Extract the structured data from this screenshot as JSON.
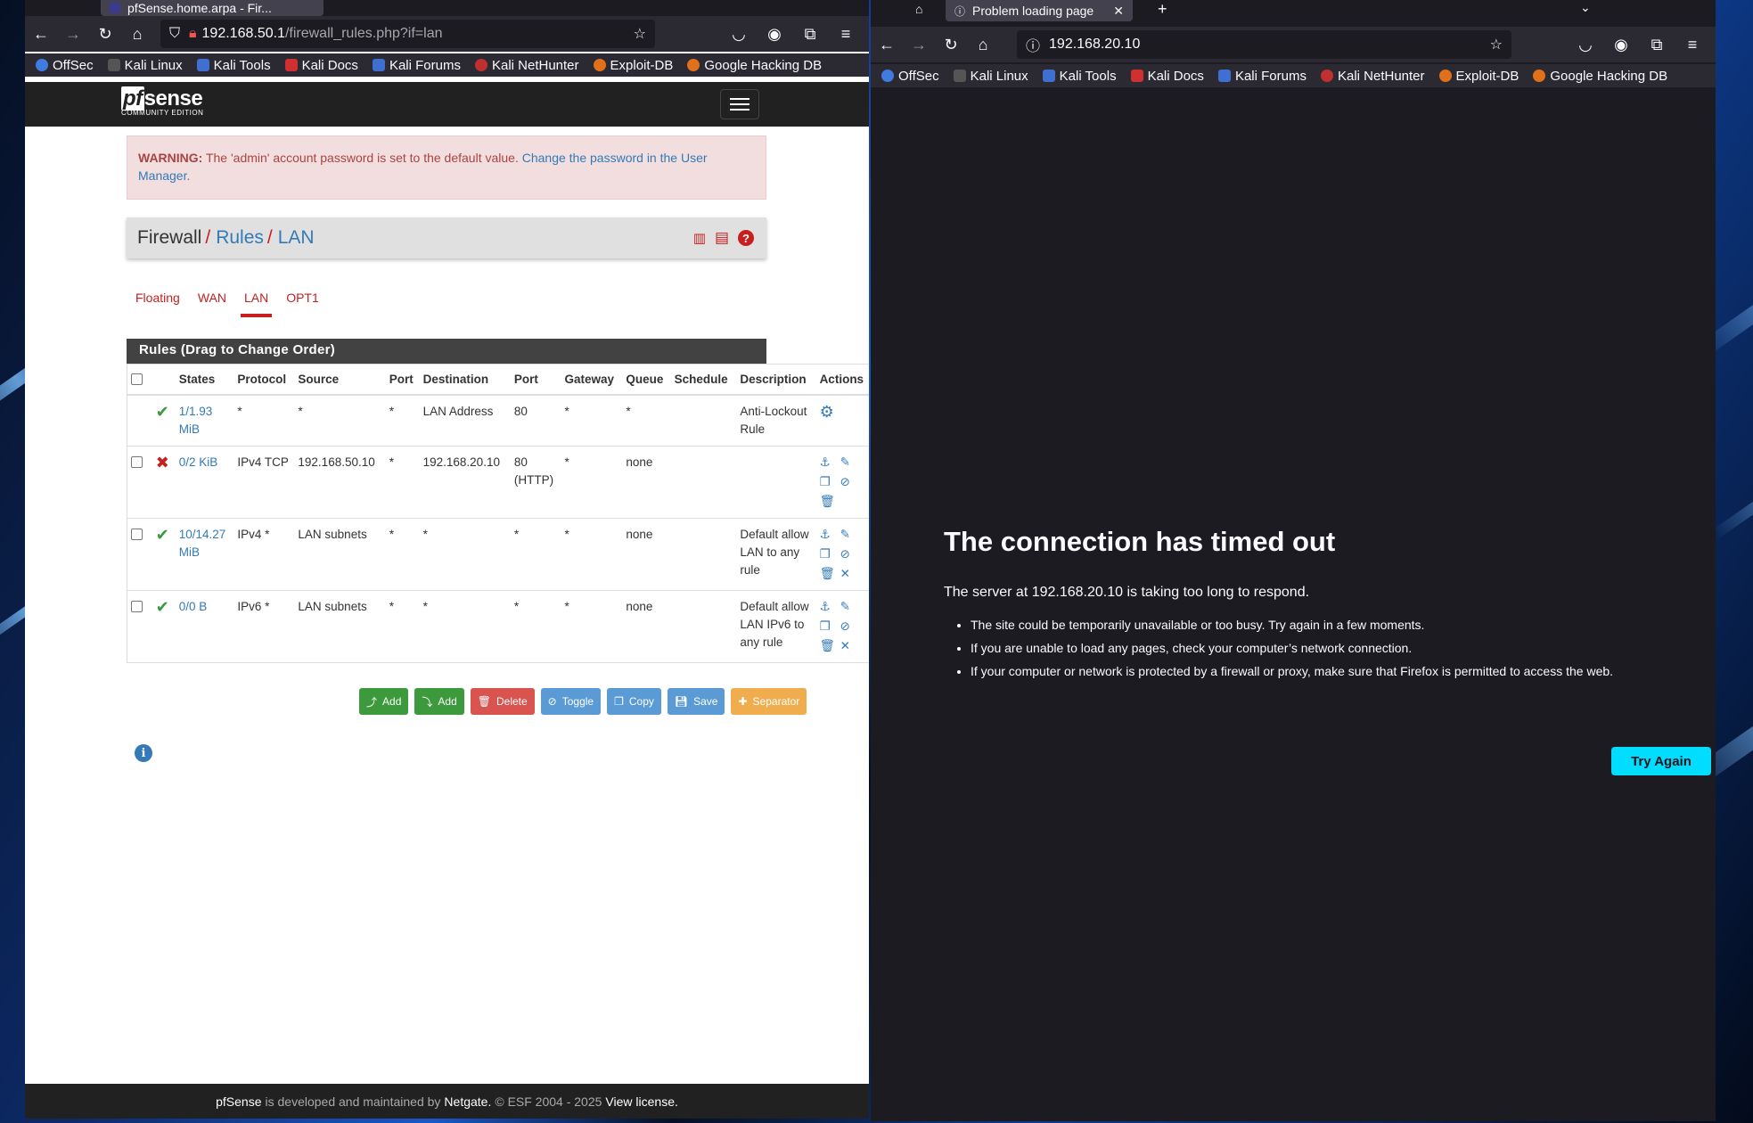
{
  "left_browser": {
    "tab_title": "pfSense.home.arpa - Fir...",
    "url_host": "192.168.50.1",
    "url_path": "/firewall_rules.php?if=lan",
    "bookmarks": [
      "OffSec",
      "Kali Linux",
      "Kali Tools",
      "Kali Docs",
      "Kali Forums",
      "Kali NetHunter",
      "Exploit-DB",
      "Google Hacking DB"
    ]
  },
  "pfsense": {
    "logo_main": "sense",
    "logo_pf": "pf",
    "logo_sub": "COMMUNITY EDITION",
    "alert_label": "WARNING:",
    "alert_text": "The 'admin' account password is set to the default value.",
    "alert_link": "Change the password in the User Manager.",
    "breadcrumb": [
      "Firewall",
      "Rules",
      "LAN"
    ],
    "tabs": [
      "Floating",
      "WAN",
      "LAN",
      "OPT1"
    ],
    "active_tab": "LAN",
    "panel_title": "Rules (Drag to Change Order)",
    "columns": [
      "States",
      "Protocol",
      "Source",
      "Port",
      "Destination",
      "Port",
      "Gateway",
      "Queue",
      "Schedule",
      "Description",
      "Actions"
    ],
    "rules": [
      {
        "status": "pass",
        "states": "1/1.93 MiB",
        "protocol": "*",
        "source": "*",
        "sport": "*",
        "destination": "LAN Address",
        "dport": "80",
        "gateway": "*",
        "queue": "*",
        "schedule": "",
        "description": "Anti-Lockout Rule"
      },
      {
        "status": "block",
        "states": "0/2 KiB",
        "protocol": "IPv4 TCP",
        "source": "192.168.50.10",
        "sport": "*",
        "destination": "192.168.20.10",
        "dport": "80 (HTTP)",
        "gateway": "*",
        "queue": "none",
        "schedule": "",
        "description": ""
      },
      {
        "status": "pass",
        "states": "10/14.27 MiB",
        "protocol": "IPv4 *",
        "source": "LAN subnets",
        "sport": "*",
        "destination": "*",
        "dport": "*",
        "gateway": "*",
        "queue": "none",
        "schedule": "",
        "description": "Default allow LAN to any rule"
      },
      {
        "status": "pass",
        "states": "0/0 B",
        "protocol": "IPv6 *",
        "source": "LAN subnets",
        "sport": "*",
        "destination": "*",
        "dport": "*",
        "gateway": "*",
        "queue": "none",
        "schedule": "",
        "description": "Default allow LAN IPv6 to any rule"
      }
    ],
    "buttons": {
      "add_top": "Add",
      "add_bottom": "Add",
      "delete": "Delete",
      "toggle": "Toggle",
      "copy": "Copy",
      "save": "Save",
      "separator": "Separator"
    },
    "footer": {
      "brand": "pfSense",
      "mid": "is developed and maintained by",
      "company": "Netgate.",
      "copy": "© ESF 2004 - 2025",
      "license": "View license."
    }
  },
  "right_browser": {
    "tab_title": "Problem loading page",
    "url": "192.168.20.10",
    "bookmarks": [
      "OffSec",
      "Kali Linux",
      "Kali Tools",
      "Kali Docs",
      "Kali Forums",
      "Kali NetHunter",
      "Exploit-DB",
      "Google Hacking DB"
    ],
    "error_title": "The connection has timed out",
    "error_desc": "The server at 192.168.20.10 is taking too long to respond.",
    "error_items": [
      "The site could be temporarily unavailable or too busy. Try again in a few moments.",
      "If you are unable to load any pages, check your computer’s network connection.",
      "If your computer or network is protected by a firewall or proxy, make sure that Firefox is permitted to access the web."
    ],
    "try_again": "Try Again"
  },
  "colors": {
    "pfsense_red": "#c71e1e",
    "link_blue": "#337ab7",
    "pass_green": "#3c9a3c",
    "firefox_accent": "#00ddff"
  }
}
